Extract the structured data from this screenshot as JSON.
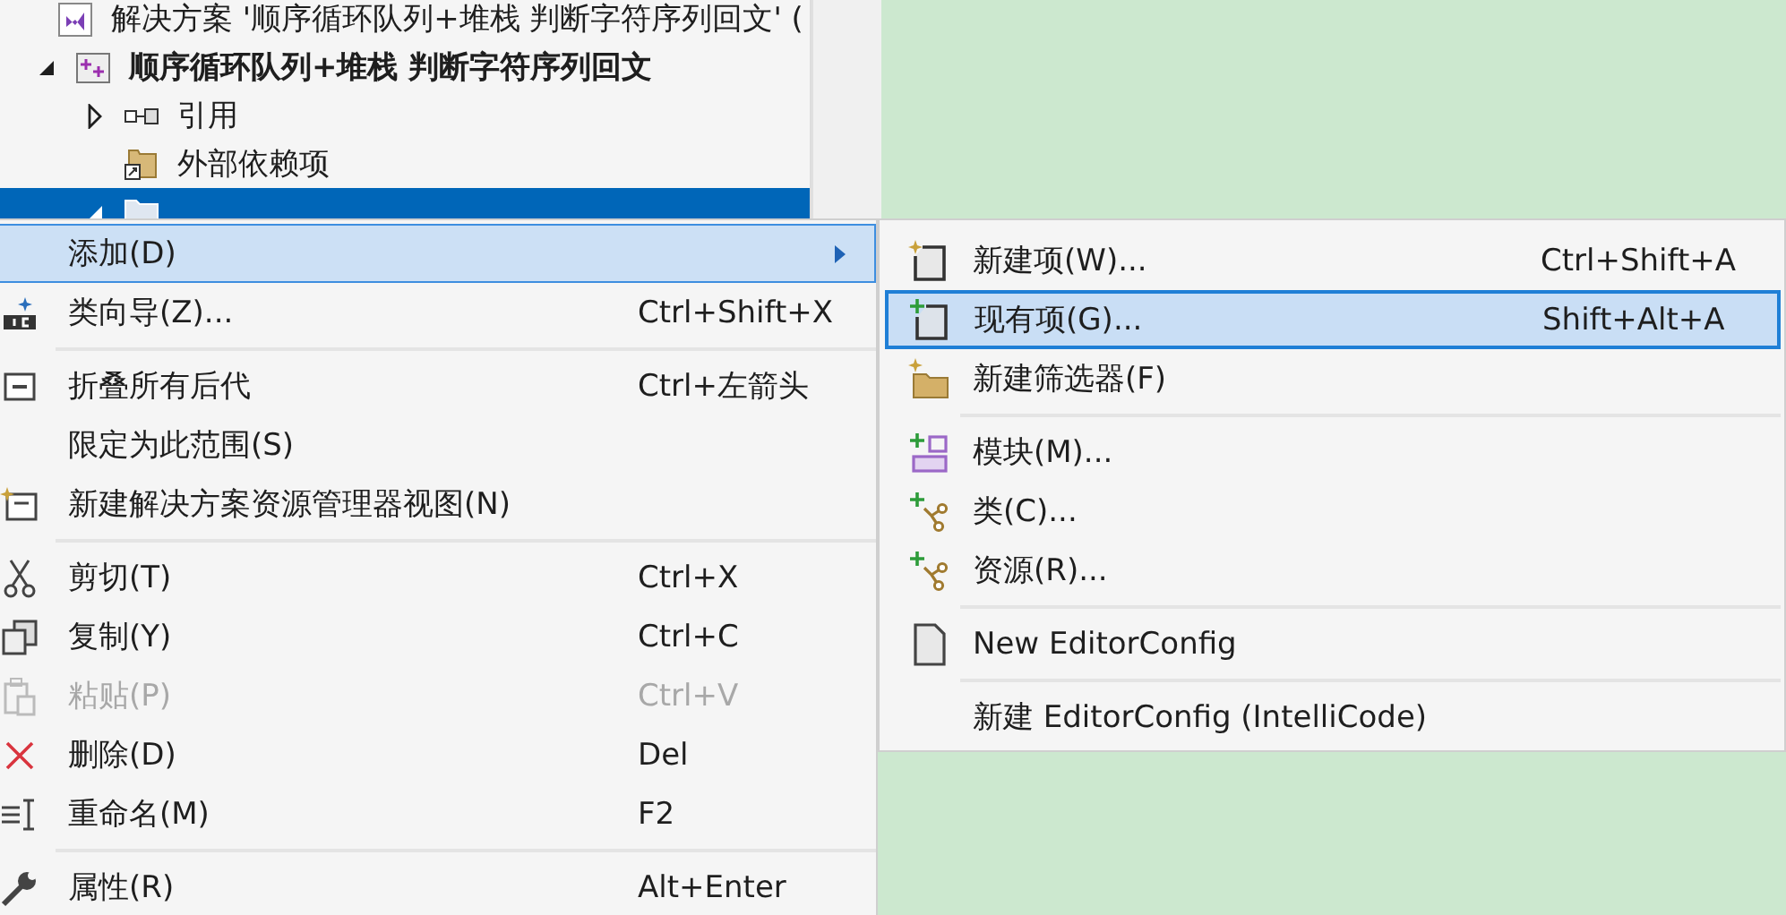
{
  "tree": {
    "label": "解决方案 '顺序循环队列+堆栈 判断字符序列回文' (",
    "kind": "solution",
    "selected": false,
    "children": [
      {
        "label": "顺序循环队列+堆栈 判断字符序列回文",
        "kind": "project",
        "expanded": true,
        "selected": false,
        "children": [
          {
            "label": "引用",
            "kind": "references",
            "expanded": false,
            "selected": false
          },
          {
            "label": "外部依赖项",
            "kind": "external",
            "selected": false
          },
          {
            "kind": "folder",
            "expanded": true,
            "selected": true
          }
        ]
      }
    ]
  },
  "context_menu": {
    "items": [
      {
        "kind": "item",
        "label": "添加(D)",
        "submenu": true,
        "selected": true,
        "disabled": false
      },
      {
        "kind": "item",
        "label": "类向导(Z)...",
        "shortcut": "Ctrl+Shift+X",
        "submenu": false,
        "selected": false,
        "disabled": false
      },
      {
        "kind": "separator"
      },
      {
        "kind": "item",
        "label": "折叠所有后代",
        "shortcut": "Ctrl+左箭头",
        "submenu": false,
        "selected": false,
        "disabled": false
      },
      {
        "kind": "item",
        "label": "限定为此范围(S)",
        "submenu": false,
        "selected": false,
        "disabled": false
      },
      {
        "kind": "item",
        "label": "新建解决方案资源管理器视图(N)",
        "submenu": false,
        "selected": false,
        "disabled": false
      },
      {
        "kind": "separator"
      },
      {
        "kind": "item",
        "label": "剪切(T)",
        "shortcut": "Ctrl+X",
        "submenu": false,
        "selected": false,
        "disabled": false
      },
      {
        "kind": "item",
        "label": "复制(Y)",
        "shortcut": "Ctrl+C",
        "submenu": false,
        "selected": false,
        "disabled": false
      },
      {
        "kind": "item",
        "label": "粘贴(P)",
        "shortcut": "Ctrl+V",
        "submenu": false,
        "selected": false,
        "disabled": true
      },
      {
        "kind": "item",
        "label": "删除(D)",
        "shortcut": "Del",
        "submenu": false,
        "selected": false,
        "disabled": false
      },
      {
        "kind": "item",
        "label": "重命名(M)",
        "shortcut": "F2",
        "submenu": false,
        "selected": false,
        "disabled": false
      },
      {
        "kind": "separator"
      },
      {
        "kind": "item",
        "label": "属性(R)",
        "shortcut": "Alt+Enter",
        "submenu": false,
        "selected": false,
        "disabled": false
      }
    ]
  },
  "submenu": {
    "items": [
      {
        "kind": "item",
        "label": "新建项(W)...",
        "shortcut": "Ctrl+Shift+A",
        "selected": false
      },
      {
        "kind": "item",
        "label": "现有项(G)...",
        "shortcut": "Shift+Alt+A",
        "selected": true
      },
      {
        "kind": "item",
        "label": "新建筛选器(F)",
        "selected": false
      },
      {
        "kind": "separator"
      },
      {
        "kind": "item",
        "label": "模块(M)...",
        "selected": false
      },
      {
        "kind": "item",
        "label": "类(C)...",
        "selected": false
      },
      {
        "kind": "item",
        "label": "资源(R)...",
        "selected": false
      },
      {
        "kind": "separator"
      },
      {
        "kind": "item",
        "label": "New EditorConfig",
        "selected": false
      },
      {
        "kind": "separator"
      },
      {
        "kind": "item",
        "label": "新建 EditorConfig (IntelliCode)",
        "selected": false
      }
    ]
  }
}
